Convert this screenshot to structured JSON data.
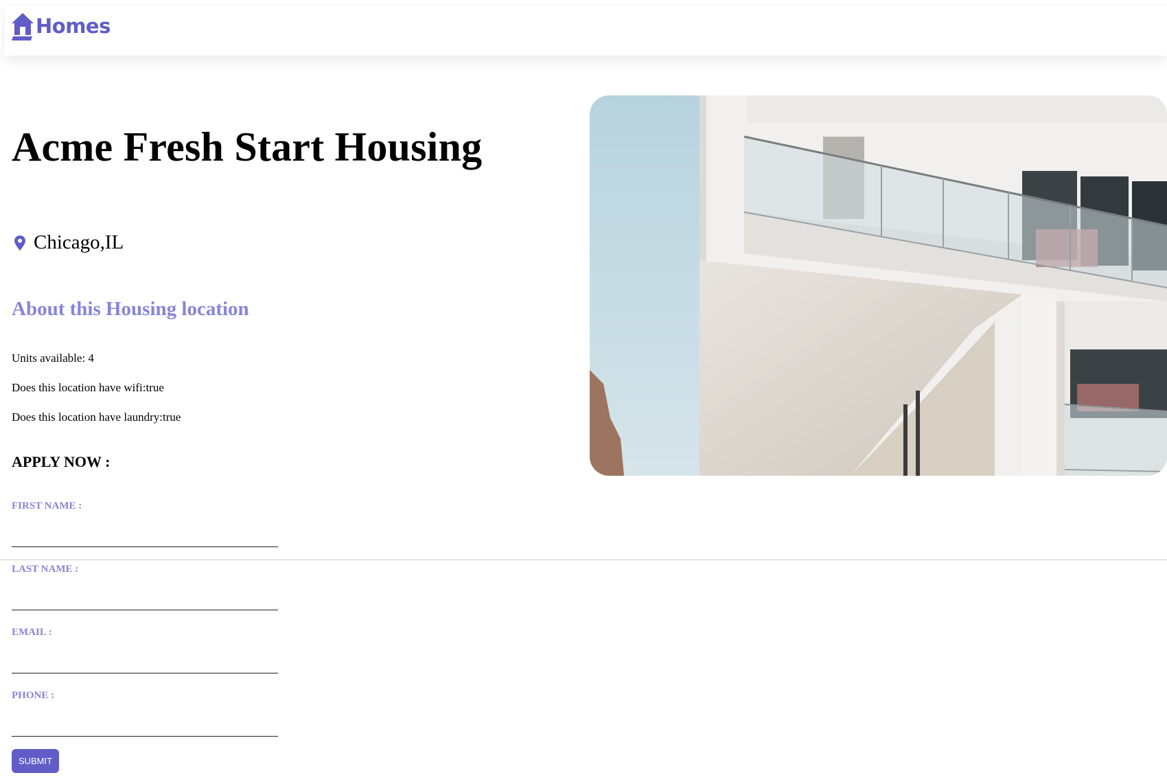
{
  "header": {
    "brand_name": "Homes",
    "logo_icon": "house-icon",
    "brand_color": "#605dc8"
  },
  "listing": {
    "name": "Acme Fresh Start Housing",
    "location": "Chicago,IL",
    "location_icon": "map-pin-icon",
    "photo_icon": "building-photo"
  },
  "about": {
    "heading": "About this Housing location",
    "heading_color": "#8785d8",
    "units": "Units available: 4",
    "wifi": "Does this location have wifi:true",
    "laundry": "Does this location have laundry:true"
  },
  "form": {
    "heading": "APPLY NOW :",
    "first_name_label": "FIRST NAME :",
    "first_name_value": "",
    "last_name_label": "LAST NAME :",
    "last_name_value": "",
    "email_label": "EMAIL :",
    "email_value": "",
    "phone_label": "PHONE :",
    "phone_value": "",
    "submit_label": "SUBMIT"
  }
}
